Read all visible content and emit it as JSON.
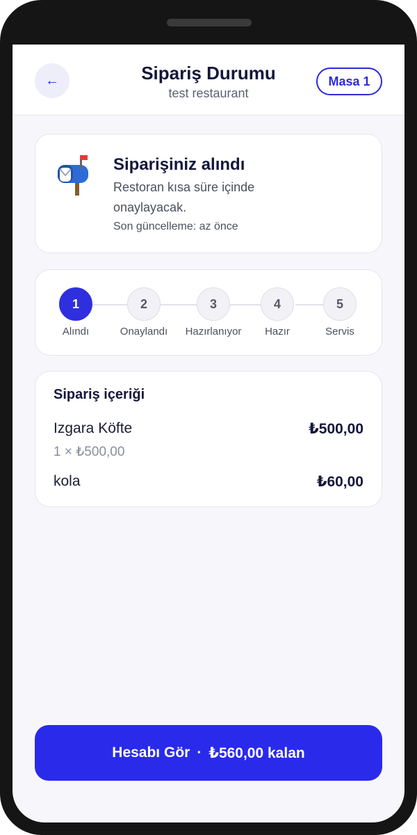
{
  "header": {
    "back_icon": "arrow-left-icon",
    "title": "Sipariş Durumu",
    "subtitle": "test restaurant",
    "table_badge": "Masa 1"
  },
  "status": {
    "icon": "mailbox-icon",
    "title": "Siparişiniz alındı",
    "description": "Restoran kısa süre içinde onaylayacak.",
    "updated": "Son güncelleme: az önce"
  },
  "steps": [
    {
      "number": "1",
      "label": "Alındı",
      "active": true
    },
    {
      "number": "2",
      "label": "Onaylandı",
      "active": false
    },
    {
      "number": "3",
      "label": "Hazırlanıyor",
      "active": false
    },
    {
      "number": "4",
      "label": "Hazır",
      "active": false
    },
    {
      "number": "5",
      "label": "Servis",
      "active": false
    }
  ],
  "order": {
    "title": "Sipariş içeriği",
    "items": [
      {
        "name": "Izgara Köfte",
        "price": "₺500,00",
        "detail": "1 × ₺500,00"
      },
      {
        "name": "kola",
        "price": "₺60,00",
        "detail": ""
      }
    ]
  },
  "cta": {
    "label": "Hesabı Gör",
    "separator": "·",
    "amount": "₺560,00 kalan"
  },
  "colors": {
    "accent": "#2a2aeb",
    "text_dark": "#14163a",
    "background": "#f7f7fb"
  }
}
